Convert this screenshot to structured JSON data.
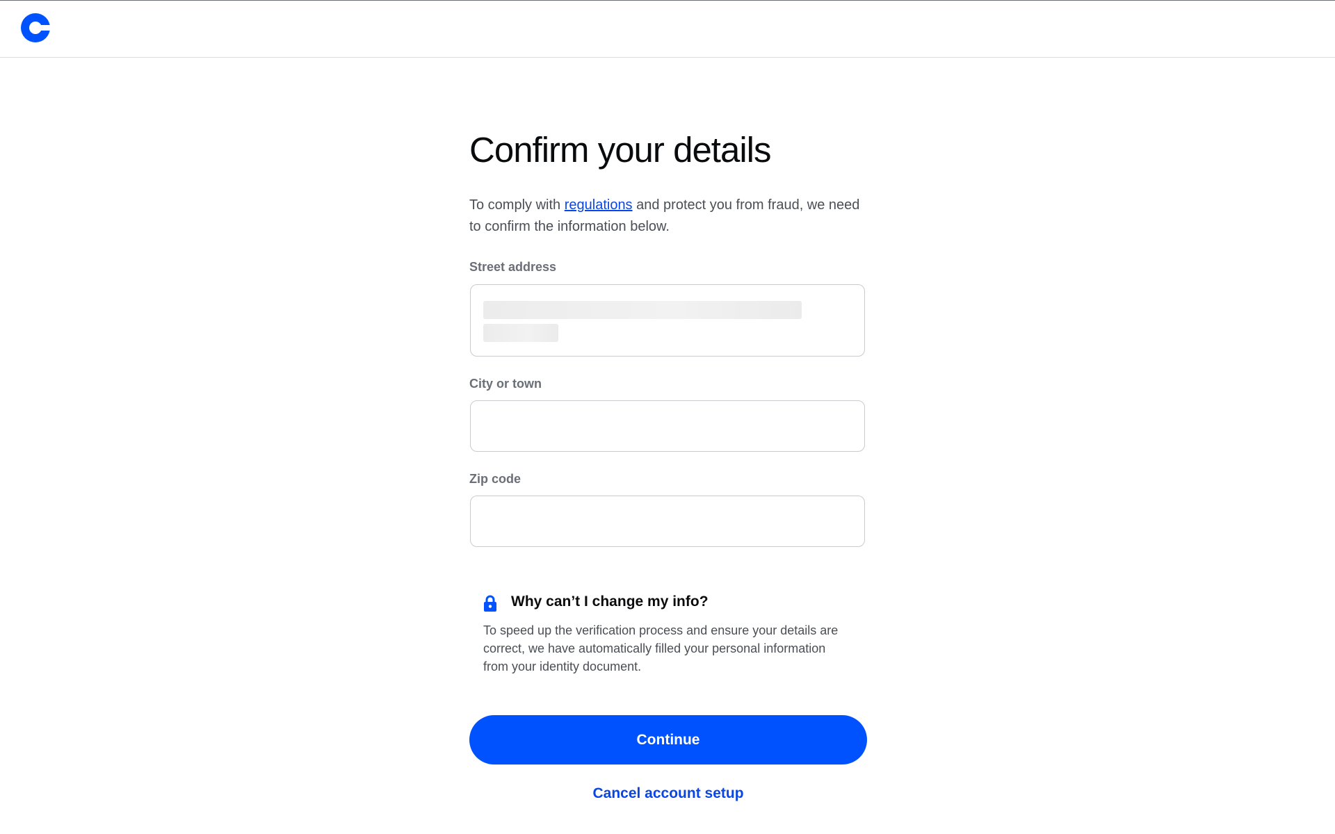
{
  "header": {
    "logo_icon": "coinbase-c-logo",
    "logo_color": "#0052ff"
  },
  "main": {
    "title": "Confirm your details",
    "intro_before": "To comply with ",
    "intro_link": "regulations",
    "intro_after": " and protect you from fraud, we need to confirm the information below."
  },
  "form": {
    "street": {
      "label": "Street address",
      "value_redacted": true
    },
    "city": {
      "label": "City or town",
      "value": ""
    },
    "zip": {
      "label": "Zip code",
      "value": ""
    }
  },
  "info": {
    "icon": "lock-icon",
    "title": "Why can’t I change my info?",
    "text": "To speed up the verification process and ensure your details are correct, we have automatically filled your personal information from your identity document."
  },
  "actions": {
    "continue_label": "Continue",
    "cancel_label": "Cancel account setup"
  },
  "colors": {
    "primary": "#0052ff",
    "link": "#0a46e4",
    "text": "#0a0b0d",
    "muted": "#4a4e55"
  }
}
